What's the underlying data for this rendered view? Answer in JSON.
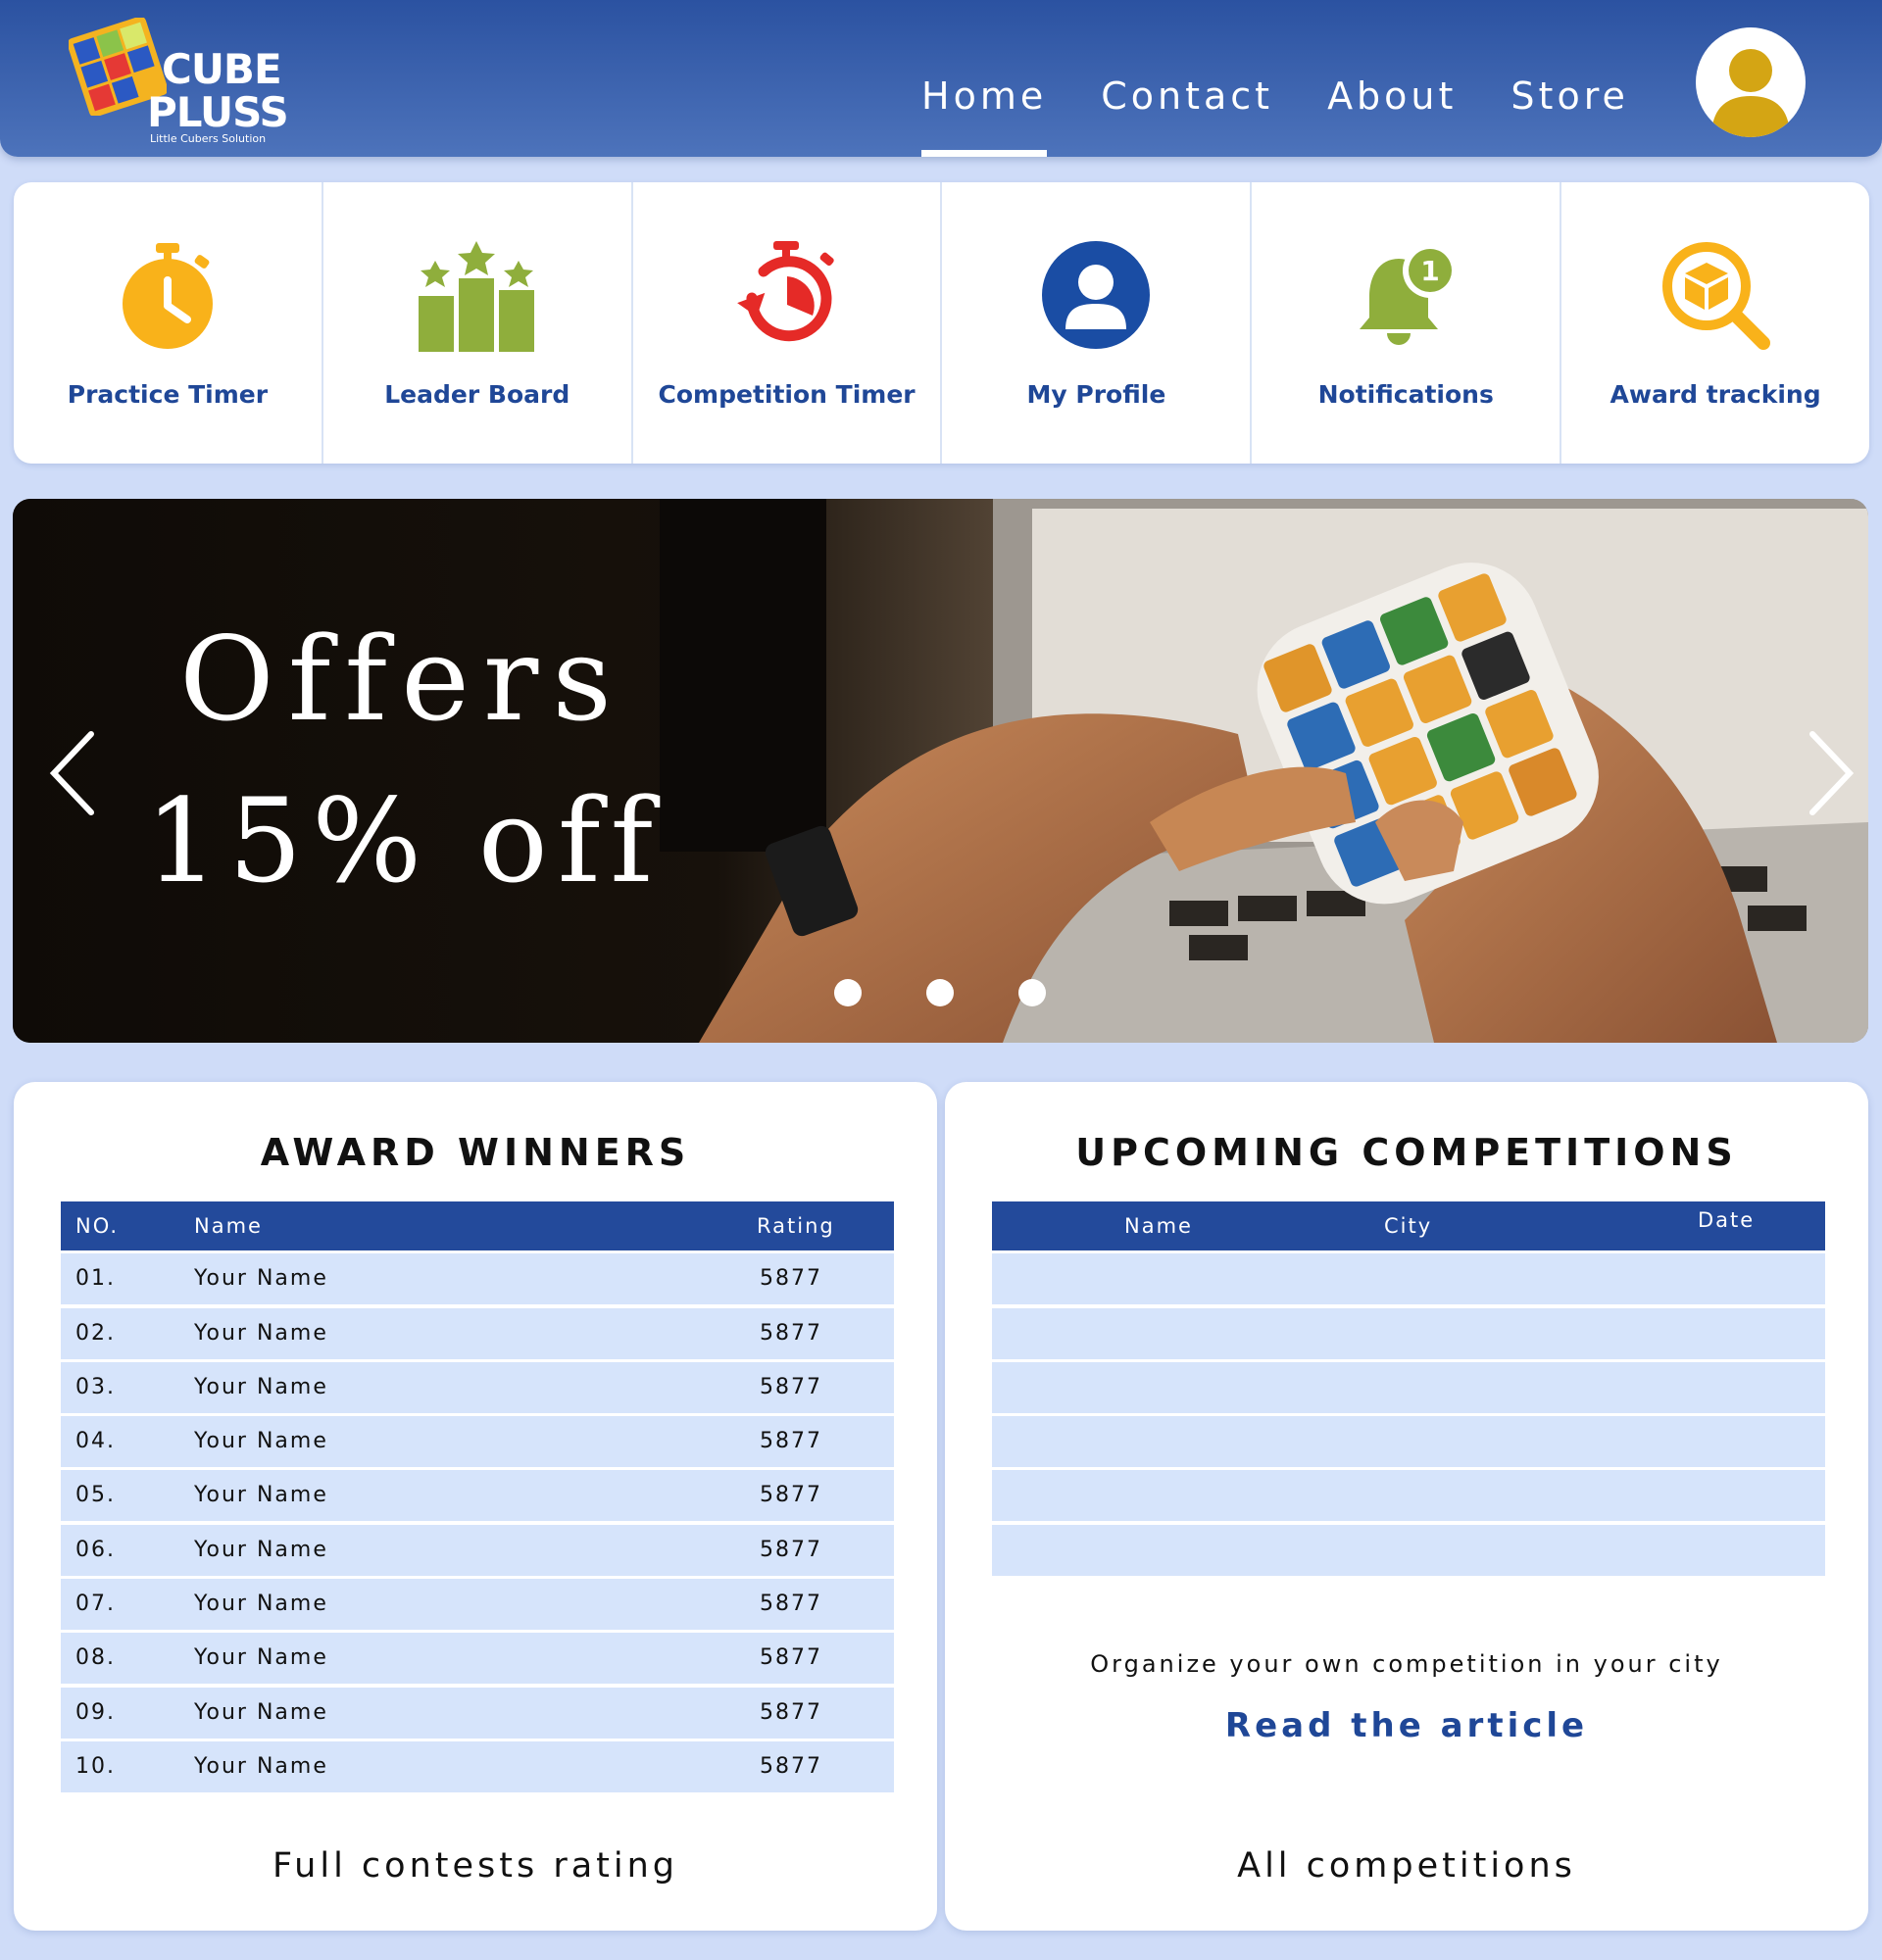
{
  "header": {
    "logo": {
      "word1": "CUBE",
      "word2": "PLUSS",
      "tagline": "Little Cubers Solution"
    },
    "nav": [
      {
        "label": "Home",
        "active": true
      },
      {
        "label": "Contact",
        "active": false
      },
      {
        "label": "About",
        "active": false
      },
      {
        "label": "Store",
        "active": false
      }
    ],
    "avatar_icon": "user-avatar-icon"
  },
  "tiles": [
    {
      "label": "Practice Timer",
      "icon": "stopwatch-icon",
      "color": "#f9b21a"
    },
    {
      "label": "Leader Board",
      "icon": "podium-stars-icon",
      "color": "#8fae3c"
    },
    {
      "label": "Competition Timer",
      "icon": "timer-reset-icon",
      "color": "#e52a27"
    },
    {
      "label": "My Profile",
      "icon": "profile-icon",
      "color": "#1a4da4"
    },
    {
      "label": "Notifications",
      "icon": "bell-icon",
      "color": "#8fae3c",
      "badge": "1"
    },
    {
      "label": "Award tracking",
      "icon": "box-search-icon",
      "color": "#f9b21a"
    }
  ],
  "banner": {
    "line1": "Offers",
    "line2": "15% off",
    "slide_count": 3,
    "prev_icon": "chevron-left-icon",
    "next_icon": "chevron-right-icon"
  },
  "award_winners": {
    "title": "AWARD WINNERS",
    "columns": [
      "NO.",
      "Name",
      "Rating"
    ],
    "rows": [
      {
        "no": "01.",
        "name": "Your Name",
        "rating": "5877"
      },
      {
        "no": "02.",
        "name": "Your Name",
        "rating": "5877"
      },
      {
        "no": "03.",
        "name": "Your Name",
        "rating": "5877"
      },
      {
        "no": "04.",
        "name": "Your Name",
        "rating": "5877"
      },
      {
        "no": "05.",
        "name": "Your Name",
        "rating": "5877"
      },
      {
        "no": "06.",
        "name": "Your Name",
        "rating": "5877"
      },
      {
        "no": "07.",
        "name": "Your Name",
        "rating": "5877"
      },
      {
        "no": "08.",
        "name": "Your Name",
        "rating": "5877"
      },
      {
        "no": "09.",
        "name": "Your Name",
        "rating": "5877"
      },
      {
        "no": "10.",
        "name": "Your Name",
        "rating": "5877"
      }
    ],
    "footer_link": "Full contests rating"
  },
  "upcoming": {
    "title": "UPCOMING COMPETITIONS",
    "columns": [
      "Name",
      "City",
      "Date"
    ],
    "rows": [
      {
        "name": "",
        "city": "",
        "date": ""
      },
      {
        "name": "",
        "city": "",
        "date": ""
      },
      {
        "name": "",
        "city": "",
        "date": ""
      },
      {
        "name": "",
        "city": "",
        "date": ""
      },
      {
        "name": "",
        "city": "",
        "date": ""
      },
      {
        "name": "",
        "city": "",
        "date": ""
      }
    ],
    "organize_text": "Organize your own competition in your city",
    "article_link": "Read the article",
    "footer_link": "All competitions"
  },
  "colors": {
    "primary": "#234a9b",
    "row_bg": "#d6e4fb",
    "page_bg": "#cfdcf8",
    "avatar": "#d4a514"
  }
}
